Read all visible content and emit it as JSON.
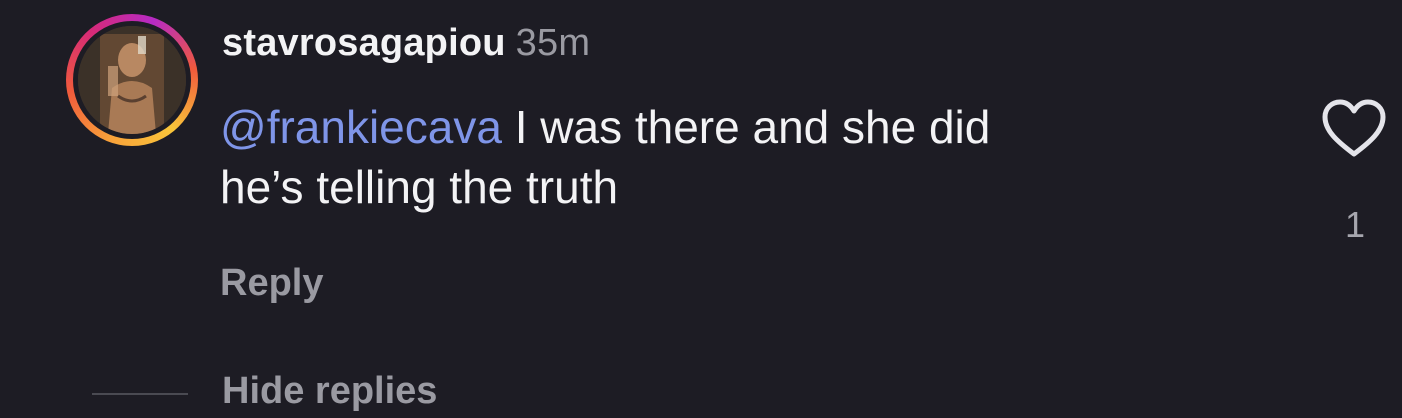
{
  "comment": {
    "username": "stavrosagapiou",
    "time_ago": "35m",
    "mention": "@frankiecava",
    "text_line1": " I was there and she did",
    "text_line2": "he’s telling the truth",
    "reply_label": "Reply",
    "like_count": "1",
    "like_icon": "heart-outline-icon"
  },
  "thread": {
    "hide_replies_label": "Hide replies"
  },
  "colors": {
    "background": "#1d1c24",
    "text": "#f3f3f5",
    "muted": "#9a9aa2",
    "mention": "#7f95e8"
  }
}
